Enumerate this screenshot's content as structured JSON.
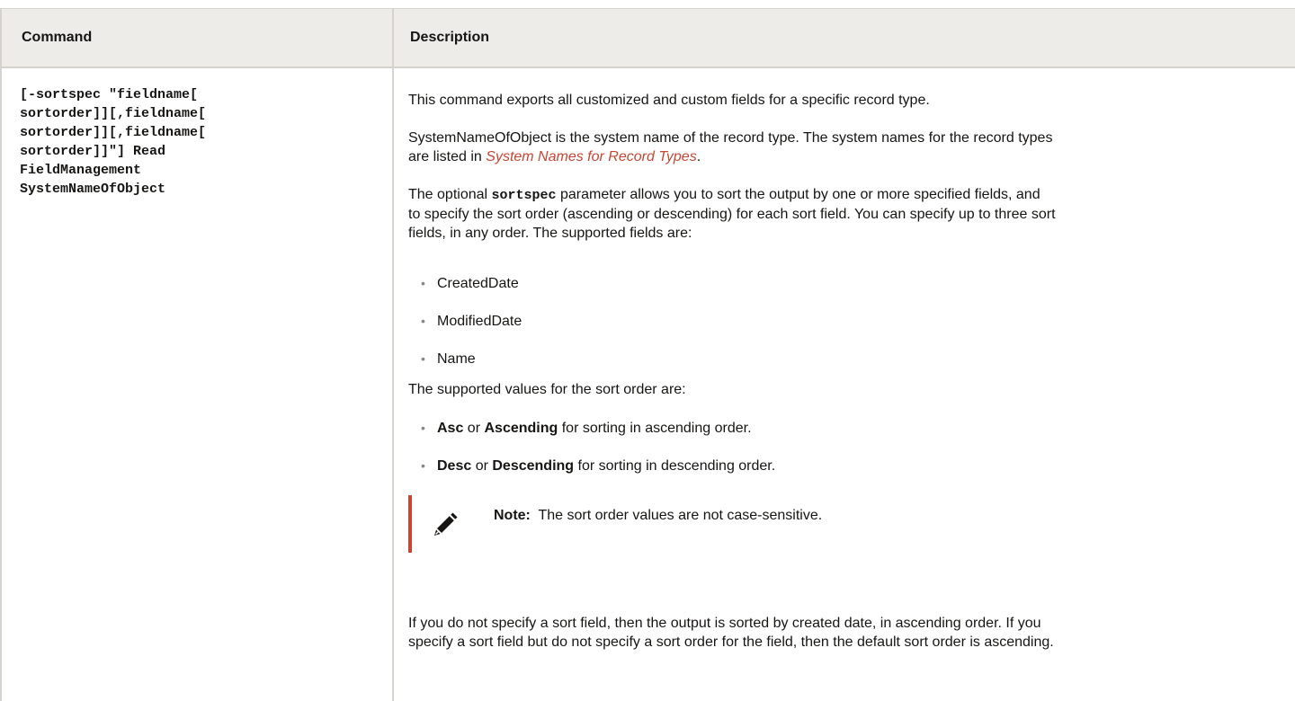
{
  "table": {
    "headers": {
      "command": "Command",
      "description": "Description"
    },
    "row": {
      "command_lines": [
        "[-sortspec \"fieldname[",
        "sortorder]][,fieldname[",
        "sortorder]][,fieldname[",
        "sortorder]]\"] Read",
        "FieldManagement",
        "SystemNameOfObject"
      ],
      "description": {
        "intro": "This command exports all customized and custom fields for a specific record type.",
        "system_name_1": "SystemNameOfObject is the system name of the record type. The system names for the record types",
        "system_name_2_prefix": "are listed in ",
        "system_name_link": "System Names for Record Types",
        "system_name_2_suffix": ".",
        "sortspec_prefix": "The optional ",
        "sortspec_code": "sortspec",
        "sortspec_line1_rest": " parameter allows you to sort the output by one or more specified fields, and",
        "sortspec_line2": "to specify the sort order (ascending or descending) for each sort field. You can specify up to three sort",
        "sortspec_line3": "fields, in any order. The supported fields are:",
        "fields": [
          "CreatedDate",
          "ModifiedDate",
          "Name"
        ],
        "values_intro": "The supported values for the sort order are:",
        "asc_a": "Asc",
        "asc_or": " or ",
        "asc_b": "Ascending",
        "asc_rest": " for sorting in ascending order.",
        "desc_a": "Desc",
        "desc_or": " or ",
        "desc_b": "Descending",
        "desc_rest": " for sorting in descending order.",
        "note_label": "Note:",
        "note_text": "  The sort order values are not case-sensitive.",
        "default_line1": "If you do not specify a sort field, then the output is sorted by created date, in ascending order. If you",
        "default_line2": "specify a sort field but do not specify a sort order for the field, then the default sort order is ascending."
      }
    }
  },
  "colors": {
    "link": "#c74634",
    "note_bar": "#c74634",
    "header_bg": "#eeece9",
    "border": "#d6d3ce"
  },
  "icons": {
    "note": "pencil-icon",
    "bullet": "bullet-dot"
  }
}
